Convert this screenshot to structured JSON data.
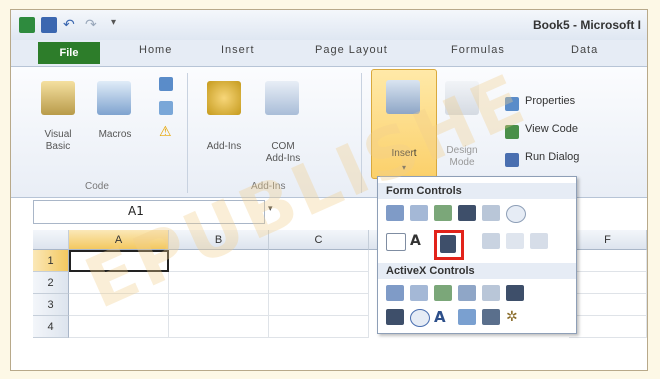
{
  "window": {
    "title": "Book5 - Microsoft I"
  },
  "tabs": [
    "File",
    "Home",
    "Insert",
    "Page Layout",
    "Formulas",
    "Data"
  ],
  "ribbon": {
    "code_group": {
      "label": "Code",
      "visual_basic": "Visual Basic",
      "macros": "Macros"
    },
    "addins_group": {
      "label": "Add-Ins",
      "addins": "Add-Ins",
      "com_addins": "COM Add-Ins"
    },
    "controls_group": {
      "insert": "Insert",
      "design_mode": "Design Mode",
      "properties": "Properties",
      "view_code": "View Code",
      "run_dialog": "Run Dialog"
    }
  },
  "formula_bar": {
    "name_box": "A1"
  },
  "sheet": {
    "columns": [
      "A",
      "B",
      "C",
      "F"
    ],
    "rows": [
      "1",
      "2",
      "3",
      "4"
    ]
  },
  "insert_dropdown": {
    "form_controls_label": "Form Controls",
    "activex_controls_label": "ActiveX Controls",
    "highlighted_control": "spin-button"
  },
  "watermark": "EPUBLISHE",
  "colors": {
    "file_tab": "#2d7d2a",
    "highlight": "#e2231a",
    "insert_button": "#fbd06a"
  }
}
